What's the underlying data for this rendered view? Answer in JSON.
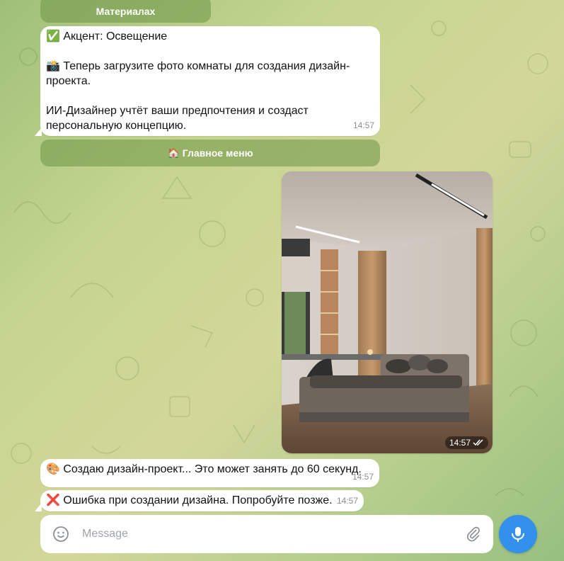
{
  "keyboard": {
    "materials_label": "Материалах",
    "main_menu_label": "🏠 Главное меню"
  },
  "messages": [
    {
      "text": "✅ Акцент: Освещение\n\n📸 Теперь загрузите фото комнаты для создания дизайн-проекта.\n\nИИ-Дизайнер учтёт ваши предпочтения и создаст персональную концепцию.",
      "time": "14:57"
    },
    {
      "text": "🎨 Создаю дизайн-проект... Это может занять до 60 секунд.",
      "time": "14:57"
    },
    {
      "text": "❌ Ошибка при создании дизайна. Попробуйте позже.",
      "time": "14:57"
    }
  ],
  "photo": {
    "time": "14:57",
    "status_icon": "double-check-icon"
  },
  "composer": {
    "placeholder": "Message"
  },
  "colors": {
    "accent": "#3390ec",
    "bubble": "#ffffff",
    "keyboard_button": "#6e9646"
  }
}
